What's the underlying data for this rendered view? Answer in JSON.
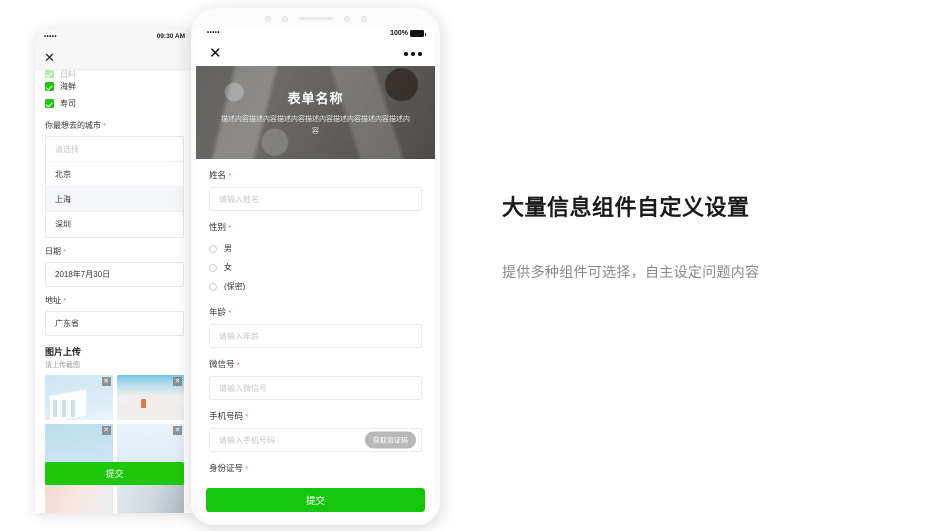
{
  "left_phone": {
    "status_bar": {
      "signal": "•••••",
      "wifi": "wifi-icon",
      "time": "09:30 AM"
    },
    "close_label": "✕",
    "checkbox_items": [
      {
        "label": "日料",
        "checked": true,
        "cut_off": true
      },
      {
        "label": "海鲜",
        "checked": true,
        "cut_off": false
      },
      {
        "label": "寿司",
        "checked": true,
        "cut_off": false
      }
    ],
    "city_field": {
      "label": "你最想去的城市",
      "required": "*",
      "placeholder": "请选择",
      "options": [
        {
          "label": "北京",
          "selected": false
        },
        {
          "label": "上海",
          "selected": true
        },
        {
          "label": "深圳",
          "selected": false
        }
      ]
    },
    "date_field": {
      "label": "日期",
      "required": "*",
      "value": "2018年7月30日"
    },
    "address_field": {
      "label": "地址",
      "required": "*",
      "value": "广东省"
    },
    "upload_section": {
      "title": "图片上传",
      "subtitle": "请上传截图",
      "remove_label": "✕"
    },
    "submit_label": "提交"
  },
  "right_phone": {
    "status_bar": {
      "signal": "•••••",
      "wifi": "wifi-icon",
      "battery_percent": "100%"
    },
    "nav": {
      "close_label": "✕",
      "more_label": "more-icon"
    },
    "banner": {
      "title": "表单名称",
      "description": "描述内容描述内容描述内容描述内容描述内容描述内容描述内容"
    },
    "fields": [
      {
        "label": "姓名",
        "required": "*",
        "type": "text",
        "placeholder": "请输入姓名"
      },
      {
        "label": "性别",
        "required": "*",
        "type": "radio",
        "options": [
          {
            "label": "男",
            "selected": false
          },
          {
            "label": "女",
            "selected": false
          },
          {
            "label": "(保密)",
            "selected": false
          }
        ]
      },
      {
        "label": "年龄",
        "required": "*",
        "type": "text",
        "placeholder": "请输入年龄"
      },
      {
        "label": "微信号",
        "required": "*",
        "type": "text",
        "placeholder": "请输入微信号"
      },
      {
        "label": "手机号码",
        "required": "*",
        "type": "text",
        "placeholder": "请输入手机号码",
        "action_label": "获取验证码"
      },
      {
        "label": "身份证号",
        "required": "*",
        "type": "text",
        "placeholder": ""
      }
    ],
    "submit_label": "提交"
  },
  "copy": {
    "heading": "大量信息组件自定义设置",
    "subtext": "提供多种组件可选择，自主设定问题内容"
  },
  "colors": {
    "primary_green": "#16c50d",
    "left_green": "#1fc70a",
    "required_red": "#fa6045",
    "heading": "#1b1b1b",
    "subtext": "#8a8a8a",
    "code_button": "#b8b8b8"
  }
}
